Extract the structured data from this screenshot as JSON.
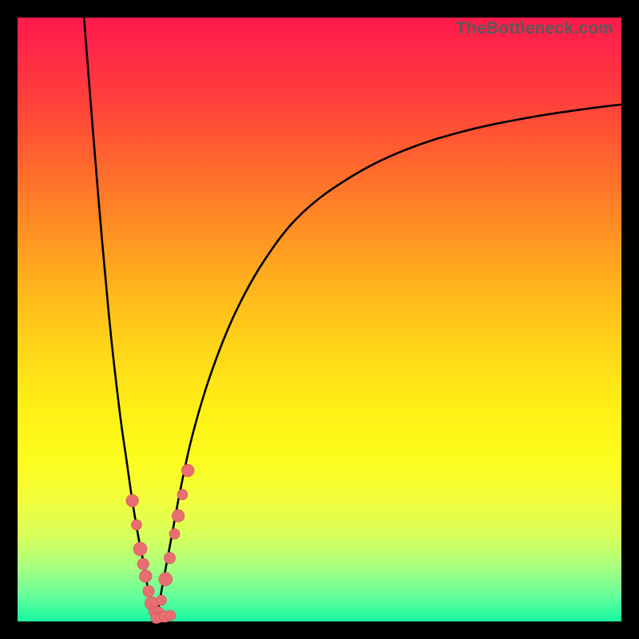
{
  "watermark": "TheBottleneck.com",
  "colors": {
    "curve_stroke": "#000000",
    "bead_fill": "#e76f71",
    "bead_stroke": "#d85a5c",
    "gradient_top": "#ff1a4b",
    "gradient_bottom": "#16f7a0"
  },
  "chart_data": {
    "type": "line",
    "title": "",
    "xlabel": "",
    "ylabel": "",
    "xlim": [
      0,
      100
    ],
    "ylim": [
      0,
      100
    ],
    "series": [
      {
        "name": "left-curve",
        "x": [
          11.0,
          12.5,
          14.0,
          15.5,
          17.0,
          18.0,
          19.0,
          20.0,
          20.8,
          21.4,
          22.0,
          22.5,
          23.0
        ],
        "y": [
          100.0,
          81.0,
          63.0,
          47.0,
          34.0,
          27.0,
          20.0,
          14.0,
          10.0,
          6.5,
          3.5,
          1.5,
          0.5
        ]
      },
      {
        "name": "right-curve",
        "x": [
          23.0,
          24.0,
          25.5,
          27.0,
          29.0,
          32.0,
          36.0,
          41.0,
          47.0,
          55.0,
          64.0,
          74.0,
          85.0,
          95.0,
          100.0
        ],
        "y": [
          0.5,
          6.0,
          14.0,
          22.0,
          31.0,
          41.0,
          51.0,
          60.0,
          67.5,
          73.5,
          78.0,
          81.2,
          83.5,
          85.0,
          85.6
        ]
      }
    ],
    "bead_clusters": [
      {
        "branch": "left",
        "beads": [
          {
            "x": 19.0,
            "y": 20.0,
            "r": 1.2
          },
          {
            "x": 19.7,
            "y": 16.0,
            "r": 1.0
          },
          {
            "x": 20.3,
            "y": 12.0,
            "r": 1.3
          },
          {
            "x": 20.8,
            "y": 9.5,
            "r": 1.1
          },
          {
            "x": 21.2,
            "y": 7.5,
            "r": 1.2
          },
          {
            "x": 21.7,
            "y": 5.0,
            "r": 1.1
          },
          {
            "x": 22.2,
            "y": 3.0,
            "r": 1.3
          },
          {
            "x": 22.6,
            "y": 1.6,
            "r": 1.0
          }
        ]
      },
      {
        "branch": "right",
        "beads": [
          {
            "x": 23.3,
            "y": 1.5,
            "r": 1.1
          },
          {
            "x": 23.8,
            "y": 3.5,
            "r": 1.0
          },
          {
            "x": 24.5,
            "y": 7.0,
            "r": 1.3
          },
          {
            "x": 25.2,
            "y": 10.5,
            "r": 1.1
          },
          {
            "x": 26.0,
            "y": 14.5,
            "r": 1.0
          },
          {
            "x": 26.6,
            "y": 17.5,
            "r": 1.2
          },
          {
            "x": 27.3,
            "y": 21.0,
            "r": 1.0
          },
          {
            "x": 28.2,
            "y": 25.0,
            "r": 1.2
          }
        ]
      },
      {
        "branch": "bottom",
        "beads": [
          {
            "x": 23.0,
            "y": 0.6,
            "r": 1.1
          },
          {
            "x": 23.6,
            "y": 0.7,
            "r": 1.0
          },
          {
            "x": 24.4,
            "y": 0.8,
            "r": 1.1
          },
          {
            "x": 25.3,
            "y": 1.0,
            "r": 1.0
          }
        ]
      }
    ]
  }
}
